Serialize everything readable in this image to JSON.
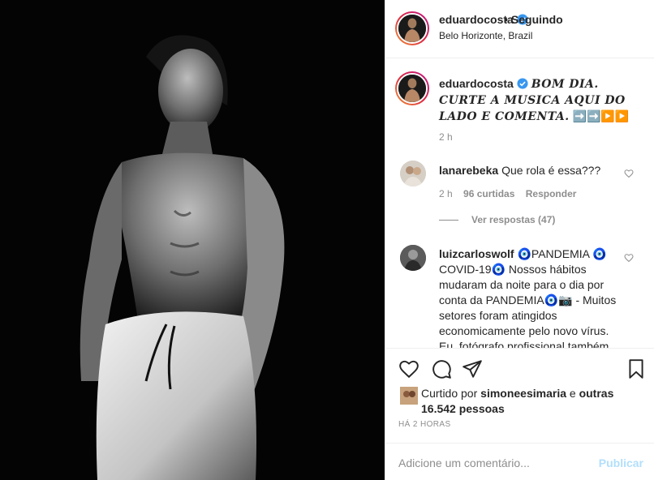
{
  "header": {
    "username": "eduardocosta",
    "follow_status": "Seguindo",
    "location": "Belo Horizonte, Brazil"
  },
  "caption": {
    "username": "eduardocosta",
    "text": "BOM DIA. CURTE A MUSICA AQUI DO LADO E COMENTA.",
    "arrows": "➡️➡️▶️▶️",
    "time": "2 h"
  },
  "comments": [
    {
      "username": "lanarebeka",
      "text": "Que rola é essa???",
      "time": "2 h",
      "likes": "96 curtidas",
      "reply_label": "Responder",
      "view_replies": "Ver respostas (47)"
    },
    {
      "username": "luizcarloswolf",
      "text": "🧿PANDEMIA 🧿 COVID-19🧿 Nossos hábitos mudaram da noite para o dia por conta da PANDEMIA🧿📷 - Muitos setores foram atingidos economicamente pelo novo vírus. Eu, fotógrafo profissional também"
    }
  ],
  "likes": {
    "prefix": "Curtido por",
    "user": "simoneesimaria",
    "joiner": "e",
    "others": "outras 16.542 pessoas"
  },
  "posted_time": "HÁ 2 HORAS",
  "add_comment": {
    "placeholder": "Adicione um comentário...",
    "publish_label": "Publicar"
  },
  "icons": {
    "verified": "verified-badge-icon",
    "like": "heart-icon",
    "comment": "comment-icon",
    "share": "paper-plane-icon",
    "save": "bookmark-icon"
  },
  "colors": {
    "verified_blue": "#3897f0",
    "publish_disabled": "#b2dffc",
    "secondary_text": "#8e8e8e"
  }
}
